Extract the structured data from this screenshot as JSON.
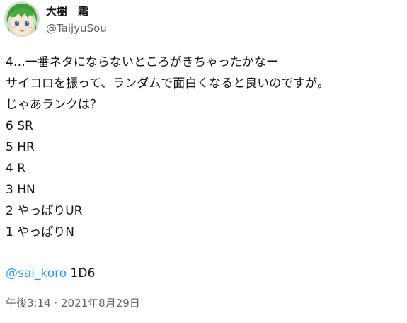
{
  "author": {
    "display_name": "大樹　霜",
    "handle": "@TaijyuSou",
    "avatar_icon": "anime-character-avatar-icon"
  },
  "tweet": {
    "lines": [
      "4…一番ネタにならないところがきちゃったかなー",
      "サイコロを振って、ランダムで面白くなると良いのですが。",
      "じゃあランクは？",
      "6 SR",
      "5 HR",
      "4 R",
      "3 HN",
      "2 やっぱりUR",
      "1 やっぱりN"
    ],
    "mention": "@sai_koro",
    "mention_suffix": " 1D6",
    "timestamp": "午後3:14 · 2021年8月29日"
  },
  "colors": {
    "text": "#0f1419",
    "secondary": "#536471",
    "link": "#1d9bf0"
  }
}
